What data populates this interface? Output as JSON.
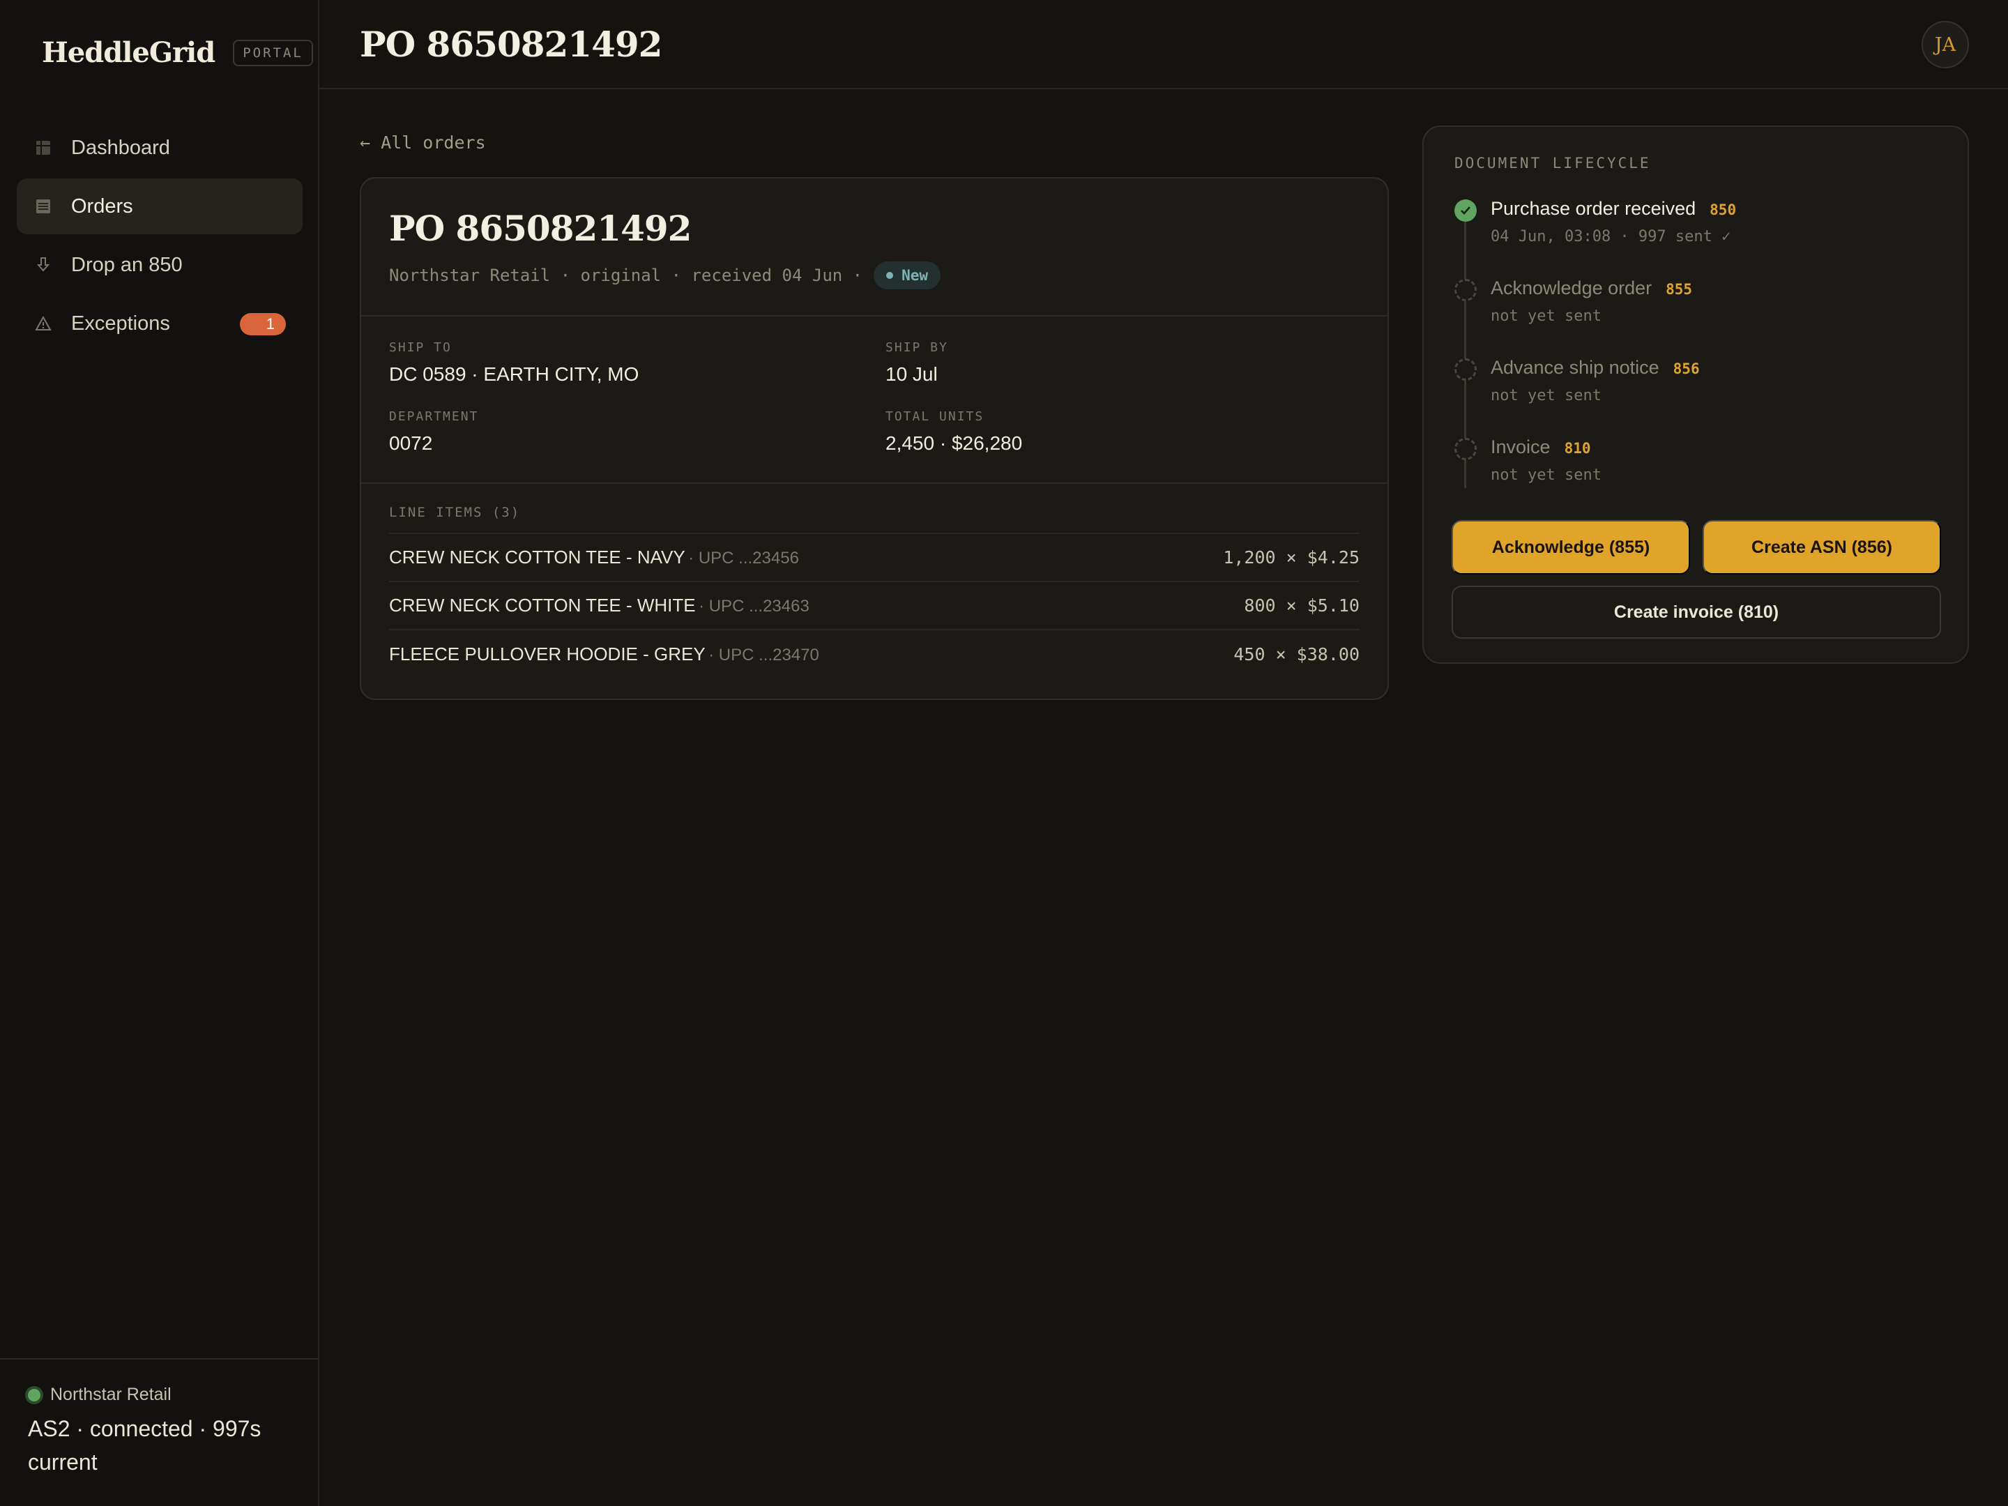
{
  "brand": {
    "name": "HeddleGrid",
    "tag": "PORTAL"
  },
  "nav": [
    {
      "label": "Dashboard",
      "icon": "grid-icon",
      "active": false
    },
    {
      "label": "Orders",
      "icon": "orders-icon",
      "active": true
    },
    {
      "label": "Drop an 850",
      "icon": "download-icon",
      "active": false
    },
    {
      "label": "Exceptions",
      "icon": "warning-icon",
      "active": false,
      "badge": "1"
    }
  ],
  "connection": {
    "partner": "Northstar Retail",
    "status": "AS2 · connected · 997s current"
  },
  "header": {
    "title": "PO 8650821492",
    "avatar": "JA"
  },
  "back_link": "← All orders",
  "order": {
    "title": "PO 8650821492",
    "meta": "Northstar Retail · original · received 04 Jun ·",
    "status": "New",
    "ship_to_label": "SHIP TO",
    "ship_to": "DC 0589 · EARTH CITY, MO",
    "ship_by_label": "SHIP BY",
    "ship_by": "10 Jul",
    "department_label": "DEPARTMENT",
    "department": "0072",
    "total_units_label": "TOTAL UNITS",
    "total_units": "2,450 · $26,280",
    "line_items_label": "LINE ITEMS (3)",
    "line_items": [
      {
        "name": "CREW NECK COTTON TEE - NAVY",
        "upc": "· UPC ...23456",
        "qty": "1,200 × $4.25"
      },
      {
        "name": "CREW NECK COTTON TEE - WHITE",
        "upc": "· UPC ...23463",
        "qty": "800 × $5.10"
      },
      {
        "name": "FLEECE PULLOVER HOODIE - GREY",
        "upc": "· UPC ...23470",
        "qty": "450 × $38.00"
      }
    ]
  },
  "lifecycle": {
    "title": "DOCUMENT LIFECYCLE",
    "steps": [
      {
        "title": "Purchase order received",
        "code": "850",
        "sub": "04 Jun, 03:08 · 997 sent ✓",
        "done": true
      },
      {
        "title": "Acknowledge order",
        "code": "855",
        "sub": "not yet sent",
        "done": false
      },
      {
        "title": "Advance ship notice",
        "code": "856",
        "sub": "not yet sent",
        "done": false
      },
      {
        "title": "Invoice",
        "code": "810",
        "sub": "not yet sent",
        "done": false
      }
    ],
    "buttons": {
      "acknowledge": "Acknowledge (855)",
      "create_asn": "Create ASN (856)",
      "create_invoice": "Create invoice (810)"
    }
  },
  "colors": {
    "accent": "#e1a42b",
    "success": "#5fa45f",
    "danger": "#d9663a",
    "status_new": "#7fb3b3"
  }
}
